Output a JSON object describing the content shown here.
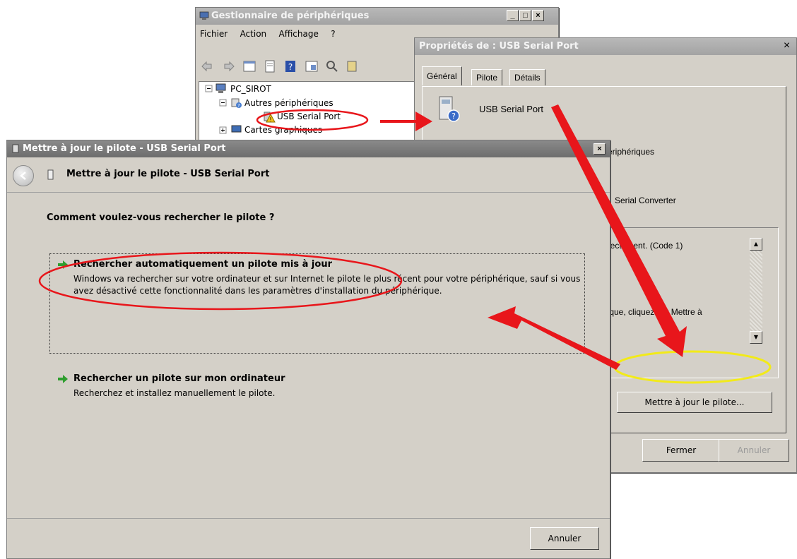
{
  "device_manager": {
    "title": "Gestionnaire de périphériques",
    "minimize": "_",
    "maximize": "□",
    "close": "×",
    "menu": [
      "Fichier",
      "Action",
      "Affichage",
      "?"
    ],
    "tree": {
      "root": "PC_SIROT",
      "other_devices": "Autres périphériques",
      "usb_serial": "USB Serial Port",
      "graphics": "Cartes graphiques"
    }
  },
  "properties": {
    "title": "Propriétés de : USB Serial Port",
    "close": "×",
    "tabs": [
      "Général",
      "Pilote",
      "Détails"
    ],
    "device_name": "USB Serial Port",
    "type_fragment": "ériphériques",
    "manufacturer_fragment": "Serial Converter",
    "status_line1": "orrectement. (Code 1)",
    "status_line2": "érique, cliquez sur Mettre à",
    "update_button": "Mettre à jour le pilote...",
    "ok_button": "Fermer",
    "cancel_button": "Annuler"
  },
  "wizard": {
    "title": "Mettre à jour le pilote - USB Serial Port",
    "close": "×",
    "header": "Mettre à jour le pilote - USB Serial Port",
    "question": "Comment voulez-vous rechercher le pilote ?",
    "option_auto": {
      "title": "Rechercher automatiquement un pilote mis à jour",
      "desc": "Windows va rechercher sur votre ordinateur et sur Internet le pilote le plus récent pour votre périphérique, sauf si vous avez désactivé cette fonctionnalité dans les paramètres d'installation du périphérique."
    },
    "option_manual": {
      "title": "Rechercher un pilote sur mon ordinateur",
      "desc": "Recherchez et installez manuellement le pilote."
    },
    "cancel_button": "Annuler"
  },
  "colors": {
    "annotation_red": "#e8161b",
    "annotation_yellow": "#f2ea19",
    "option_arrow_green": "#2e9e2e"
  }
}
